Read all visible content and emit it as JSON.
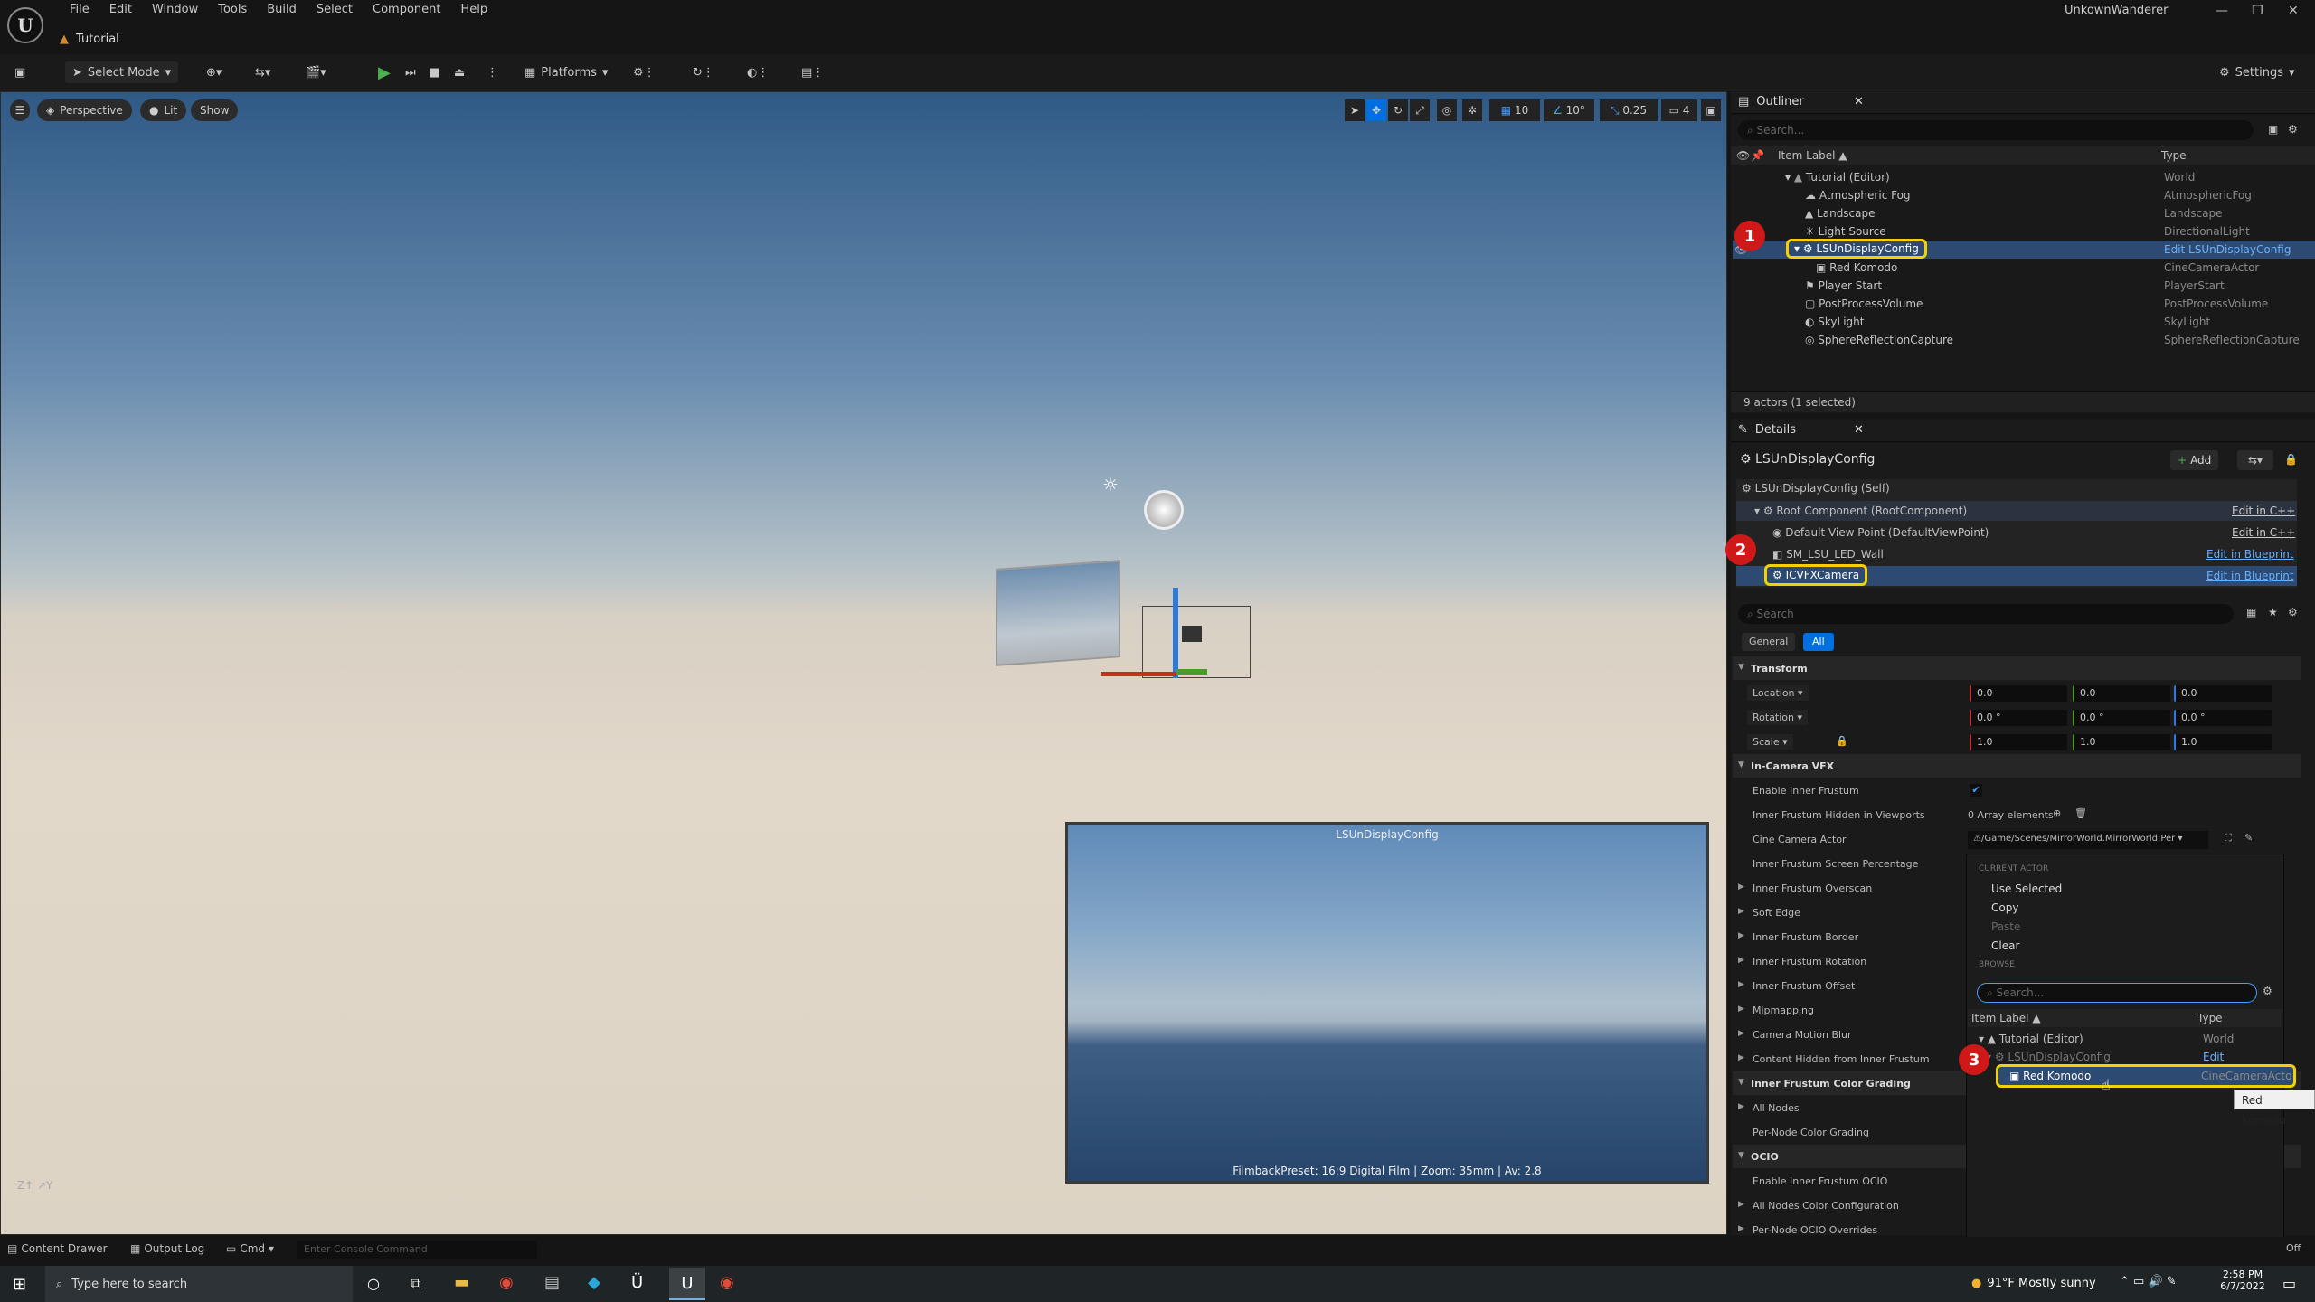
{
  "menu": [
    "File",
    "Edit",
    "Window",
    "Tools",
    "Build",
    "Select",
    "Component",
    "Help"
  ],
  "tab_title": "Tutorial",
  "user": "UnkownWanderer",
  "toolbar": {
    "select_mode": "Select Mode",
    "platforms": "Platforms",
    "settings": "Settings"
  },
  "viewport": {
    "perspective": "Perspective",
    "lit": "Lit",
    "show": "Show",
    "grid_snap": "10",
    "rot_snap": "10°",
    "scale_snap": "0.25",
    "cam_speed": "4",
    "preview_title": "LSUnDisplayConfig",
    "preview_caption": "FilmbackPreset: 16:9 Digital Film | Zoom: 35mm | Av: 2.8"
  },
  "outliner": {
    "title": "Outliner",
    "search_placeholder": "Search...",
    "col_label": "Item Label ▲",
    "col_type": "Type",
    "status": "9 actors (1 selected)",
    "rows": [
      {
        "label": "Tutorial (Editor)",
        "type": "World"
      },
      {
        "label": "Atmospheric Fog",
        "type": "AtmosphericFog"
      },
      {
        "label": "Landscape",
        "type": "Landscape"
      },
      {
        "label": "Light Source",
        "type": "DirectionalLight"
      },
      {
        "label": "LSUnDisplayConfig",
        "type": "Edit LSUnDisplayConfig"
      },
      {
        "label": "Red Komodo",
        "type": "CineCameraActor"
      },
      {
        "label": "Player Start",
        "type": "PlayerStart"
      },
      {
        "label": "PostProcessVolume",
        "type": "PostProcessVolume"
      },
      {
        "label": "SkyLight",
        "type": "SkyLight"
      },
      {
        "label": "SphereReflectionCapture",
        "type": "SphereReflectionCapture"
      }
    ]
  },
  "details": {
    "title": "Details",
    "actor": "LSUnDisplayConfig",
    "add": "Add",
    "components": [
      {
        "label": "LSUnDisplayConfig (Self)",
        "link": ""
      },
      {
        "label": "Root Component (RootComponent)",
        "link": "Edit in C++"
      },
      {
        "label": "Default View Point (DefaultViewPoint)",
        "link": "Edit in C++"
      },
      {
        "label": "SM_LSU_LED_Wall",
        "link": "Edit in Blueprint"
      },
      {
        "label": "ICVFXCamera",
        "link": "Edit in Blueprint"
      }
    ],
    "search_placeholder": "Search",
    "filter_general": "General",
    "filter_all": "All",
    "transform": "Transform",
    "location": "Location",
    "rotation": "Rotation",
    "scale": "Scale",
    "loc": [
      "0.0",
      "0.0",
      "0.0"
    ],
    "rot": [
      "0.0 °",
      "0.0 °",
      "0.0 °"
    ],
    "scl": [
      "1.0",
      "1.0",
      "1.0"
    ],
    "props": [
      "In-Camera VFX",
      "Enable Inner Frustum",
      "Inner Frustum Hidden in Viewports",
      "Cine Camera Actor",
      "Inner Frustum Screen Percentage",
      "Inner Frustum Overscan",
      "Soft Edge",
      "Inner Frustum Border",
      "Inner Frustum Rotation",
      "Inner Frustum Offset",
      "Mipmapping",
      "Camera Motion Blur",
      "Content Hidden from Inner Frustum",
      "Inner Frustum Color Grading",
      "All Nodes",
      "Per-Node Color Grading",
      "OCIO",
      "Enable Inner Frustum OCIO",
      "All Nodes Color Configuration",
      "Per-Node OCIO Overrides"
    ],
    "array_elements": "0 Array elements",
    "cine_path": "/Game/Scenes/MirrorWorld.MirrorWorld:Per"
  },
  "popup": {
    "current_actor": "CURRENT ACTOR",
    "use_selected": "Use Selected",
    "copy": "Copy",
    "paste": "Paste",
    "clear": "Clear",
    "browse": "BROWSE",
    "search_placeholder": "Search...",
    "col_label": "Item Label ▲",
    "col_type": "Type",
    "rows": [
      {
        "label": "Tutorial (Editor)",
        "type": "World"
      },
      {
        "label": "LSUnDisplayConfig",
        "type": "Edit LSUnDispla"
      },
      {
        "label": "Red Komodo",
        "type": "CineCameraActo"
      }
    ],
    "tooltip": "Red Komodo"
  },
  "badges": [
    "1",
    "2",
    "3"
  ],
  "statusbar": {
    "content_drawer": "Content Drawer",
    "output_log": "Output Log",
    "cmd": "Cmd",
    "console_placeholder": "Enter Console Command",
    "off": "Off"
  },
  "taskbar": {
    "search_placeholder": "Type here to search",
    "weather": "91°F  Mostly sunny",
    "time": "2:58 PM",
    "date": "6/7/2022"
  }
}
